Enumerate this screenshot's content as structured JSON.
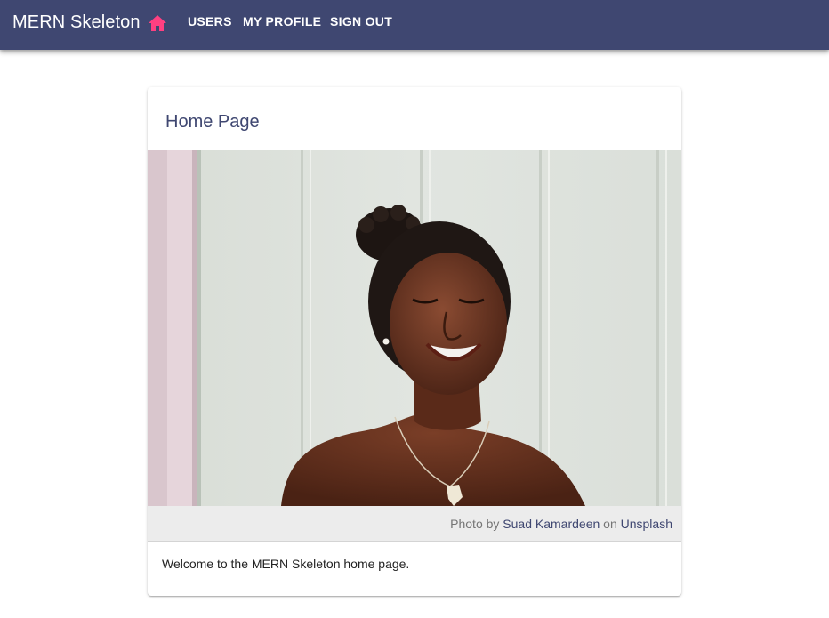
{
  "app": {
    "title": "MERN Skeleton"
  },
  "nav": {
    "home_icon": "home-icon",
    "users_label": "USERS",
    "profile_label": "MY PROFILE",
    "signout_label": "SIGN OUT"
  },
  "card": {
    "title": "Home Page",
    "credit": {
      "prefix": "Photo by",
      "author": "Suad Kamardeen",
      "middle": "on",
      "source": "Unsplash"
    },
    "body": "Welcome to the MERN Skeleton home page."
  },
  "colors": {
    "appbar": "#3f4771",
    "home_icon": "#ff4081",
    "title": "#3f4771",
    "caption_bg": "#ececec"
  }
}
